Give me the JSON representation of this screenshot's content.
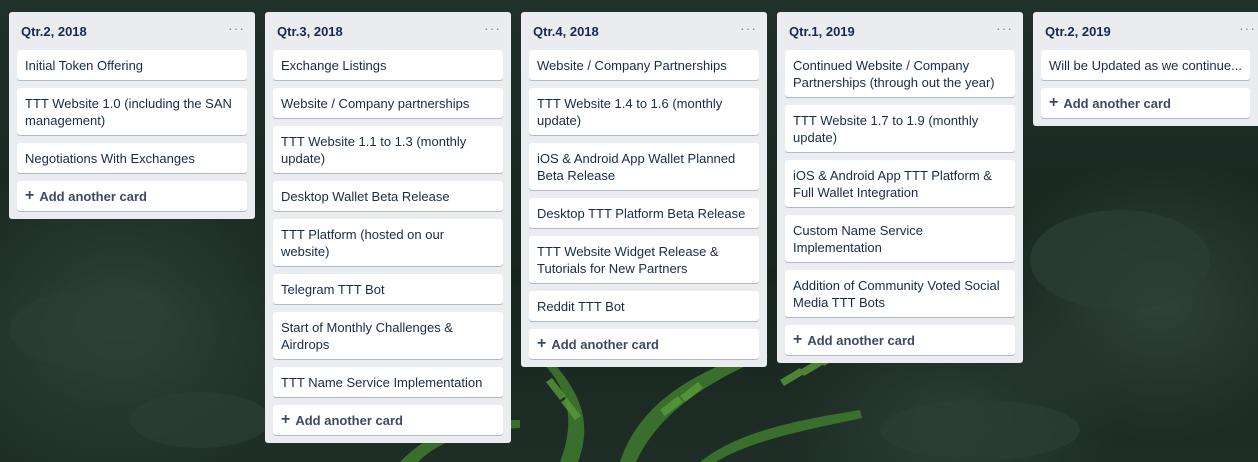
{
  "lists": [
    {
      "title": "Qtr.2, 2018",
      "menu": "···",
      "cards": [
        "Initial Token Offering",
        "TTT Website 1.0 (including the SAN management)",
        "Negotiations With Exchanges"
      ],
      "add_label": "Add another card"
    },
    {
      "title": "Qtr.3, 2018",
      "menu": "···",
      "cards": [
        "Exchange Listings",
        "Website / Company partnerships",
        "TTT Website 1.1 to 1.3 (monthly update)",
        "Desktop Wallet Beta Release",
        "TTT Platform (hosted on our website)",
        "Telegram TTT Bot",
        "Start of Monthly Challenges & Airdrops",
        "TTT Name Service Implementation"
      ],
      "add_label": "Add another card"
    },
    {
      "title": "Qtr.4, 2018",
      "menu": "···",
      "cards": [
        "Website / Company Partnerships",
        "TTT Website 1.4 to 1.6 (monthly update)",
        "iOS & Android App Wallet Planned Beta Release",
        "Desktop TTT Platform Beta Release",
        "TTT Website Widget Release & Tutorials for New Partners",
        "Reddit TTT Bot"
      ],
      "add_label": "Add another card"
    },
    {
      "title": "Qtr.1, 2019",
      "menu": "···",
      "cards": [
        "Continued Website / Company Partnerships (through out the year)",
        "TTT Website 1.7 to 1.9 (monthly update)",
        "iOS & Android App TTT Platform & Full Wallet Integration",
        "Custom Name Service Implementation",
        "Addition of Community Voted Social Media TTT Bots"
      ],
      "add_label": "Add another card"
    },
    {
      "title": "Qtr.2, 2019",
      "menu": "···",
      "cards": [
        "Will be Updated as we continue..."
      ],
      "add_label": "Add another card"
    }
  ],
  "icons": {
    "list_menu": "more-horizontal-icon",
    "add": "plus-icon"
  },
  "colors": {
    "list_bg": "#ebecf0",
    "card_bg": "#ffffff",
    "text": "#172b4d",
    "board_bg": "#1b2a22"
  }
}
